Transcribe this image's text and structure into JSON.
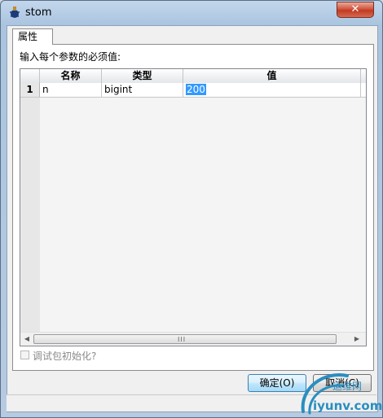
{
  "window": {
    "title": "stom",
    "close_glyph": "✕"
  },
  "tabs": [
    {
      "label": "属性",
      "active": true
    }
  ],
  "prompt": "输入每个参数的必须值:",
  "grid": {
    "columns": [
      "名称",
      "类型",
      "值"
    ],
    "rows": [
      {
        "number": "1",
        "name": "n",
        "type": "bigint",
        "value": "200"
      }
    ],
    "scroll_left_glyph": "◀",
    "scroll_right_glyph": "▶",
    "scroll_grip_glyph": "III"
  },
  "checkbox": {
    "label": "调试包初始化?",
    "checked": false,
    "enabled": false
  },
  "buttons": {
    "ok": "确定(O)",
    "cancel": "取消(C)"
  },
  "watermark": {
    "brand": "运维网",
    "site": "iyunv.com"
  },
  "colors": {
    "selection": "#3399ff",
    "default_button_border": "#3c7fb1",
    "close_button": "#c23a22",
    "watermark": "#2a8ec0"
  },
  "icons": {
    "app": "process-icon",
    "close": "close-icon"
  }
}
